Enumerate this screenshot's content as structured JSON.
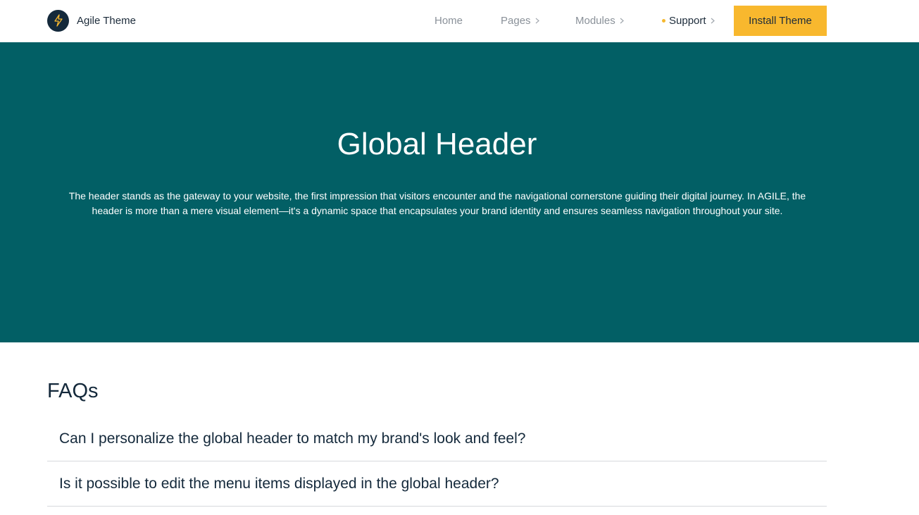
{
  "header": {
    "brand_name": "Agile Theme",
    "nav": {
      "home": "Home",
      "pages": "Pages",
      "modules": "Modules",
      "support": "Support"
    },
    "install_button": "Install Theme"
  },
  "hero": {
    "title": "Global Header",
    "description": "The header stands as the gateway to your website, the first impression that visitors encounter and the navigational cornerstone guiding their digital journey. In AGILE, the header is more than a mere visual element—it's a dynamic space that encapsulates your brand identity and ensures seamless navigation throughout your site."
  },
  "faqs": {
    "heading": "FAQs",
    "items": [
      {
        "question": "Can I personalize the global header to match my brand's look and feel?"
      },
      {
        "question": "Is it possible to edit the menu items displayed in the global header?"
      }
    ]
  },
  "colors": {
    "hero_background": "#025f65",
    "accent": "#f8b82e",
    "text_dark": "#14293b"
  },
  "icons": {
    "brand": "lightning-bolt-icon",
    "nav_chevron": "chevron-right-icon",
    "active_indicator": "dot-icon"
  }
}
